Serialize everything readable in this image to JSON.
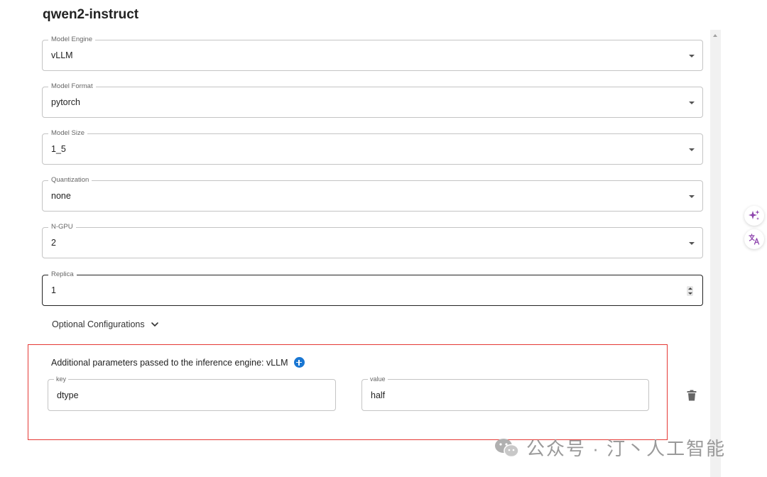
{
  "page": {
    "title": "qwen2-instruct"
  },
  "fields": [
    {
      "label": "Model Engine",
      "value": "vLLM"
    },
    {
      "label": "Model Format",
      "value": "pytorch"
    },
    {
      "label": "Model Size",
      "value": "1_5"
    },
    {
      "label": "Quantization",
      "value": "none"
    },
    {
      "label": "N-GPU",
      "value": "2"
    },
    {
      "label": "Replica",
      "value": "1"
    }
  ],
  "optional": {
    "label": "Optional Configurations"
  },
  "additional": {
    "label": "Additional parameters passed to the inference engine: vLLM",
    "key_label": "key",
    "key_value": "dtype",
    "value_label": "value",
    "value_value": "half"
  },
  "watermark": {
    "text": "公众号 · 汀丶人工智能"
  },
  "icons": {
    "dropdown": "chevron-down-icon",
    "add": "plus-circle-icon",
    "delete": "trash-icon",
    "ai": "sparkle-icon",
    "translate": "translate-icon"
  },
  "colors": {
    "accent": "#1976d2",
    "highlight_border": "#e53935",
    "ai_icon": "#8e44ad"
  }
}
